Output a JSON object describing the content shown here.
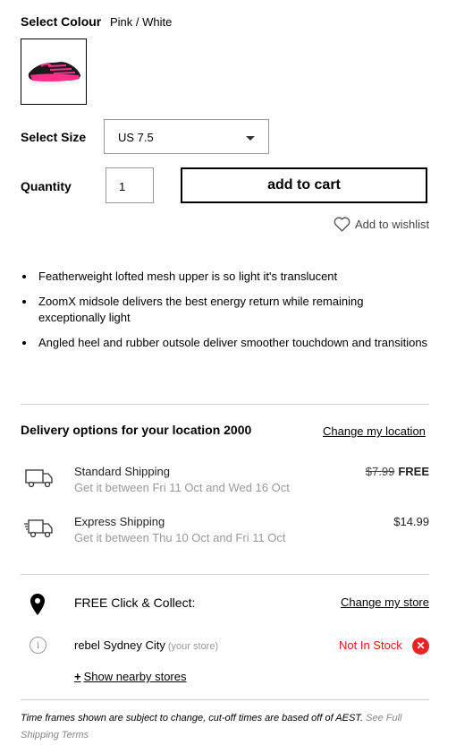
{
  "colour": {
    "label": "Select Colour",
    "value": "Pink / White"
  },
  "size": {
    "label": "Select Size",
    "selected": "US 7.5"
  },
  "quantity": {
    "label": "Quantity",
    "value": "1"
  },
  "cart": {
    "button_label": "add to cart"
  },
  "wishlist": {
    "label": "Add to wishlist",
    "icon": "heart-icon"
  },
  "features": [
    "Featherweight lofted mesh upper is so light it's translucent",
    "ZoomX midsole delivers the best energy return while remaining exceptionally light",
    "Angled heel and rubber outsole deliver smoother touchdown and transitions"
  ],
  "delivery": {
    "title": "Delivery options for your location 2000",
    "change_location": "Change my location",
    "options": [
      {
        "name": "Standard Shipping",
        "window": "Get it between Fri 11 Oct and Wed 16 Oct",
        "old_price": "$7.99",
        "price": "FREE",
        "icon": "truck-icon"
      },
      {
        "name": "Express Shipping",
        "window": "Get it between Thu 10 Oct and Fri 11 Oct",
        "price": "$14.99",
        "icon": "fast-truck-icon"
      }
    ]
  },
  "click_collect": {
    "title": "FREE Click & Collect:",
    "change_store": "Change my store",
    "store": {
      "name": "rebel Sydney City",
      "tag": "(your store)",
      "status": "Not In Stock"
    },
    "nearby": {
      "plus": "+",
      "label": "Show nearby stores"
    }
  },
  "footnote": {
    "text": "Time frames shown are subject to change, cut-off times are based off of AEST.",
    "link": "See Full Shipping Terms"
  },
  "colors": {
    "stock_red": "#e01b1b",
    "shoe_pink": "#ff2f8a"
  }
}
